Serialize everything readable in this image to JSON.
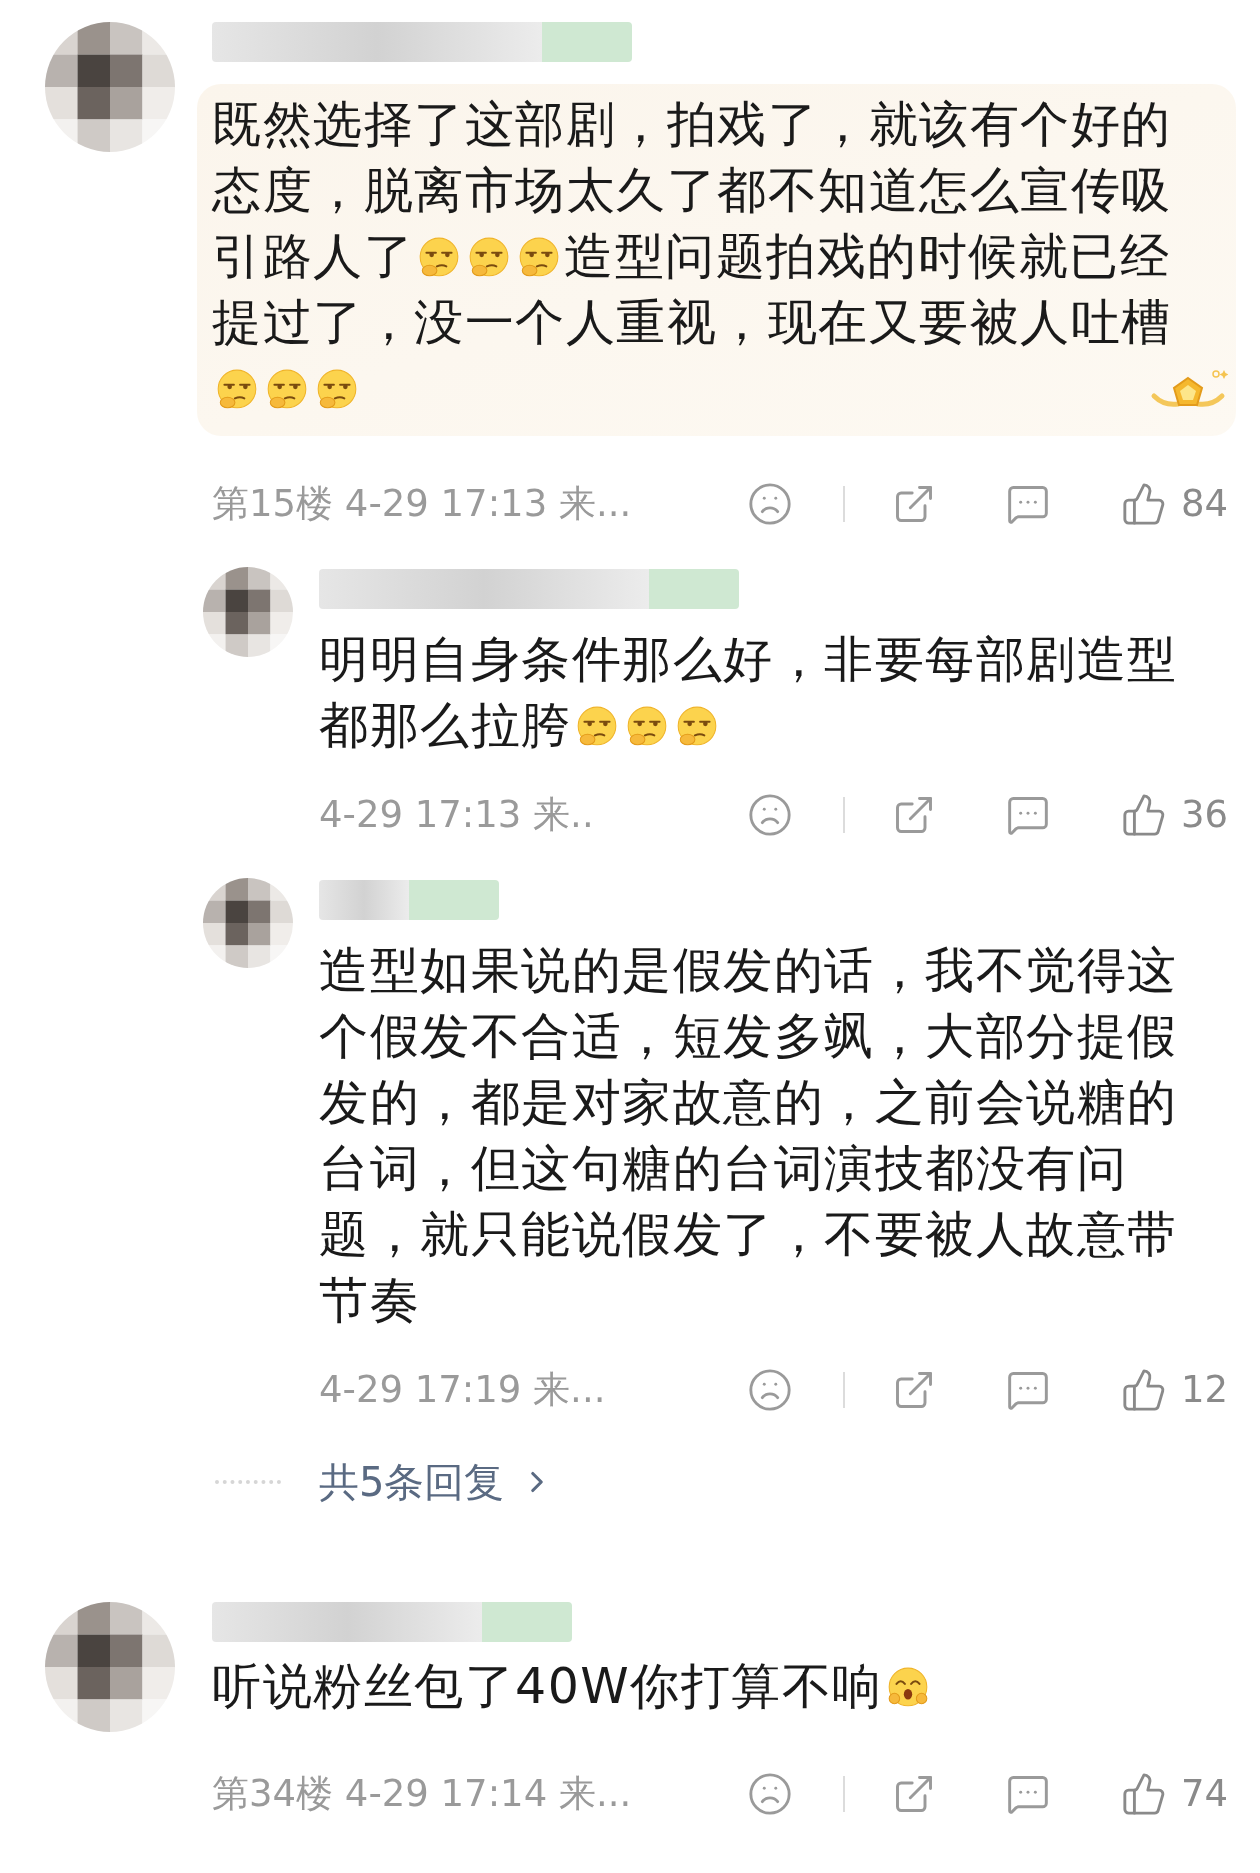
{
  "comments": [
    {
      "featured": true,
      "content": [
        {
          "kind": "text",
          "text": "既然选择了这部剧，拍戏了，就该有个好的态度，脱离市场太久了都不知道怎么宣传吸引路人了"
        },
        {
          "kind": "smirk_emoji"
        },
        {
          "kind": "smirk_emoji"
        },
        {
          "kind": "smirk_emoji"
        },
        {
          "kind": "text",
          "text": "造型问题拍戏的时候就已经提过了，没一个人重视，现在又要被人吐槽"
        },
        {
          "kind": "smirk_emoji"
        },
        {
          "kind": "smirk_emoji"
        },
        {
          "kind": "smirk_emoji"
        }
      ],
      "meta": "第15楼 4-29 17:13 来...",
      "likes": "84",
      "replies": [
        {
          "content": [
            {
              "kind": "text",
              "text": "明明自身条件那么好，非要每部剧造型都那么拉胯"
            },
            {
              "kind": "smirk_emoji"
            },
            {
              "kind": "smirk_emoji"
            },
            {
              "kind": "smirk_emoji"
            }
          ],
          "meta": "4-29 17:13 来..",
          "likes": "36"
        },
        {
          "content": [
            {
              "kind": "text",
              "text": "造型如果说的是假发的话，我不觉得这个假发不合适，短发多飒，大部分提假发的，都是对家故意的，之前会说糖的台词，但这句糖的台词演技都没有问题，就只能说假发了，不要被人故意带节奏"
            }
          ],
          "meta": "4-29 17:19 来...",
          "likes": "12"
        }
      ],
      "more_replies": "共5条回复"
    },
    {
      "featured": false,
      "content": [
        {
          "kind": "text",
          "text": "听说粉丝包了40W你打算不响"
        },
        {
          "kind": "smile_emoji"
        }
      ],
      "meta": "第34楼 4-29 17:14 来...",
      "likes": "74"
    }
  ]
}
